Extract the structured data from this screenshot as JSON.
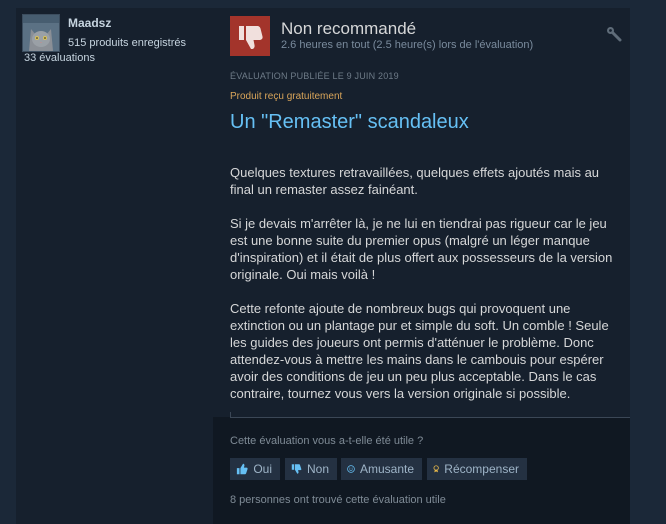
{
  "author": {
    "name": "Maadsz",
    "products_owned": "515 produits enregistrés",
    "reviews_count": "33 évaluations"
  },
  "review": {
    "verdict": "Non recommandé",
    "hours": "2.6 heures en tout (2.5 heure(s) lors de l'évaluation)",
    "posted": "ÉVALUATION PUBLIÉE LE 9 JUIN 2019",
    "received_free": "Produit reçu gratuitement",
    "title": "Un \"Remaster\" scandaleux",
    "paragraphs": [
      "Quelques textures retravaillées, quelques effets ajoutés mais au final un remaster assez fainéant.",
      "Si je devais m'arrêter là, je ne lui en tiendrai pas rigueur car le jeu est une bonne suite du premier opus (malgré un léger manque d'inspiration) et il était de plus offert aux possesseurs de la version originale. Oui mais voilà !",
      "Cette refonte ajoute de nombreux bugs qui provoquent une extinction ou un plantage pur et simple du soft. Un comble ! Seule les guides des joueurs ont permis d'atténuer le problème. Donc attendez-vous à mettre les mains dans le cambouis pour espérer avoir des conditions de jeu un peu plus acceptable. Dans le cas contraire, tournez vous vers la version originale si possible."
    ]
  },
  "feedback": {
    "question": "Cette évaluation vous a-t-elle été utile ?",
    "buttons": {
      "yes": "Oui",
      "no": "Non",
      "funny": "Amusante",
      "award": "Récompenser"
    },
    "helpful_count": "8 personnes ont trouvé cette évaluation utile"
  },
  "colors": {
    "background": "#1b2838",
    "thumbs_down": "#a3342b",
    "title_link": "#66c0f4",
    "received_free": "#d9a55a"
  },
  "icons": {
    "vote": "thumbs-down-icon",
    "hours": "wrench-icon",
    "yes": "thumbs-up-icon",
    "no": "thumbs-down-icon",
    "funny": "smiley-icon",
    "award": "award-icon"
  }
}
